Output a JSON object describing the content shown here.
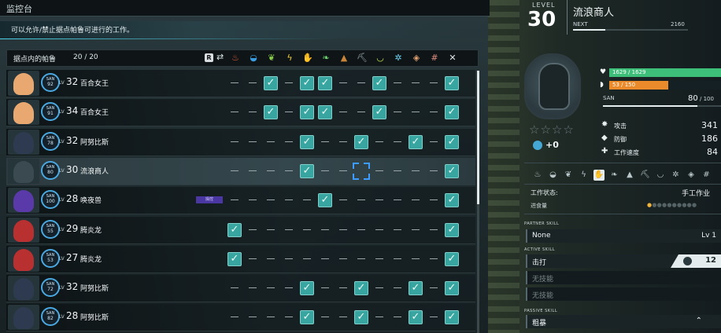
{
  "left": {
    "title": "监控台",
    "description": "可以允许/禁止据点帕鲁可进行的工作。",
    "list_title": "据点内的帕鲁",
    "list_count": "20 / 20",
    "sort_key": "R",
    "work_icons": [
      {
        "name": "kindling-icon",
        "glyph": "♨",
        "color": "#e05a3a"
      },
      {
        "name": "watering-icon",
        "glyph": "◒",
        "color": "#3a9de0"
      },
      {
        "name": "planting-icon",
        "glyph": "❦",
        "color": "#8bd04a"
      },
      {
        "name": "electricity-icon",
        "glyph": "ϟ",
        "color": "#f0d040"
      },
      {
        "name": "handiwork-icon",
        "glyph": "✋",
        "color": "#f0c8a0"
      },
      {
        "name": "gathering-icon",
        "glyph": "❧",
        "color": "#6ccf6c"
      },
      {
        "name": "lumbering-icon",
        "glyph": "▲",
        "color": "#c8853a"
      },
      {
        "name": "mining-icon",
        "glyph": "⛏",
        "color": "#a0aab0"
      },
      {
        "name": "medicine-icon",
        "glyph": "◡",
        "color": "#c0e050"
      },
      {
        "name": "cooling-icon",
        "glyph": "✲",
        "color": "#6ad0f0"
      },
      {
        "name": "transporting-icon",
        "glyph": "◈",
        "color": "#e0a070"
      },
      {
        "name": "farming-icon",
        "glyph": "#",
        "color": "#e08f80"
      },
      {
        "name": "disable-all-icon",
        "glyph": "✕",
        "color": "#dfe7ea"
      }
    ],
    "pals": [
      {
        "name": "百合女王",
        "level": "32",
        "san_label": "SAN",
        "san": "92",
        "portrait_color": "#e8a870",
        "tag": "",
        "work": "0,0,2,0,2,2,0,0,2,0,0,0,2"
      },
      {
        "name": "百合女王",
        "level": "34",
        "san_label": "SAN",
        "san": "91",
        "portrait_color": "#e8a870",
        "tag": "",
        "work": "0,0,2,0,2,2,0,0,2,0,0,0,2"
      },
      {
        "name": "阿努比斯",
        "level": "32",
        "san_label": "SAN",
        "san": "78",
        "portrait_color": "#2d3a4f",
        "tag": "",
        "work": "0,0,0,0,2,0,0,2,0,0,2,0,2"
      },
      {
        "name": "流浪商人",
        "level": "30",
        "san_label": "SAN",
        "san": "80",
        "portrait_color": "#3a4a50",
        "tag": "",
        "work": "0,0,0,0,2,0,0,3,0,0,0,0,2"
      },
      {
        "name": "唤夜兽",
        "level": "28",
        "san_label": "SAN",
        "san": "100",
        "portrait_color": "#5a3aa8",
        "tag": "操控",
        "work": "0,0,0,0,0,2,0,0,0,0,0,0,2"
      },
      {
        "name": "腾炎龙",
        "level": "29",
        "san_label": "SAN",
        "san": "55",
        "portrait_color": "#b83030",
        "tag": "",
        "work": "2,0,0,0,0,0,0,0,0,0,0,0,2"
      },
      {
        "name": "腾炎龙",
        "level": "27",
        "san_label": "SAN",
        "san": "53",
        "portrait_color": "#b83030",
        "tag": "",
        "work": "2,0,0,0,0,0,0,0,0,0,0,0,2"
      },
      {
        "name": "阿努比斯",
        "level": "32",
        "san_label": "SAN",
        "san": "72",
        "portrait_color": "#2d3a4f",
        "tag": "",
        "work": "0,0,0,0,2,0,0,2,0,0,2,0,2"
      },
      {
        "name": "阿努比斯",
        "level": "28",
        "san_label": "SAN",
        "san": "82",
        "portrait_color": "#2d3a4f",
        "tag": "",
        "work": "0,0,0,0,2,0,0,2,0,0,2,0,2"
      }
    ],
    "selected_index": 3
  },
  "right": {
    "level_label": "LEVEL",
    "level": "30",
    "name": "流浪商人",
    "next_label": "NEXT",
    "next_value": "2160",
    "xp_progress": 0.28,
    "stars": "☆☆☆☆",
    "rank_bonus": "+0",
    "hp_text": "1629 / 1629",
    "hp_progress": 1.0,
    "food_text": "53 / 150",
    "food_progress": 0.53,
    "san_label": "SAN",
    "san_value": "80",
    "san_max": "/ 100",
    "san_progress": 0.8,
    "stats": [
      {
        "icon": "attack-icon",
        "glyph": "✸",
        "label": "攻击",
        "value": "341"
      },
      {
        "icon": "defense-icon",
        "glyph": "◆",
        "label": "防御",
        "value": "186"
      },
      {
        "icon": "work-speed-icon",
        "glyph": "✚",
        "label": "工作速度",
        "value": "84"
      }
    ],
    "work_state_label": "工作状态:",
    "work_state_value": "手工作业",
    "satiety_label": "进食量",
    "satiety_dots": "● ● ● ● ● ● ● ● ●",
    "partner_skill_label": "PARTNER SKILL",
    "partner_skill": "None",
    "partner_skill_level": "Lv 1",
    "active_skill_label": "ACTIVE SKILL",
    "active_skills": [
      "击打",
      "无技能",
      "无技能"
    ],
    "active_skill_power": "12",
    "passive_skill_label": "PASSIVE SKILL",
    "passive_skill": "粗暴",
    "passive_skill_marker": "⌃"
  }
}
